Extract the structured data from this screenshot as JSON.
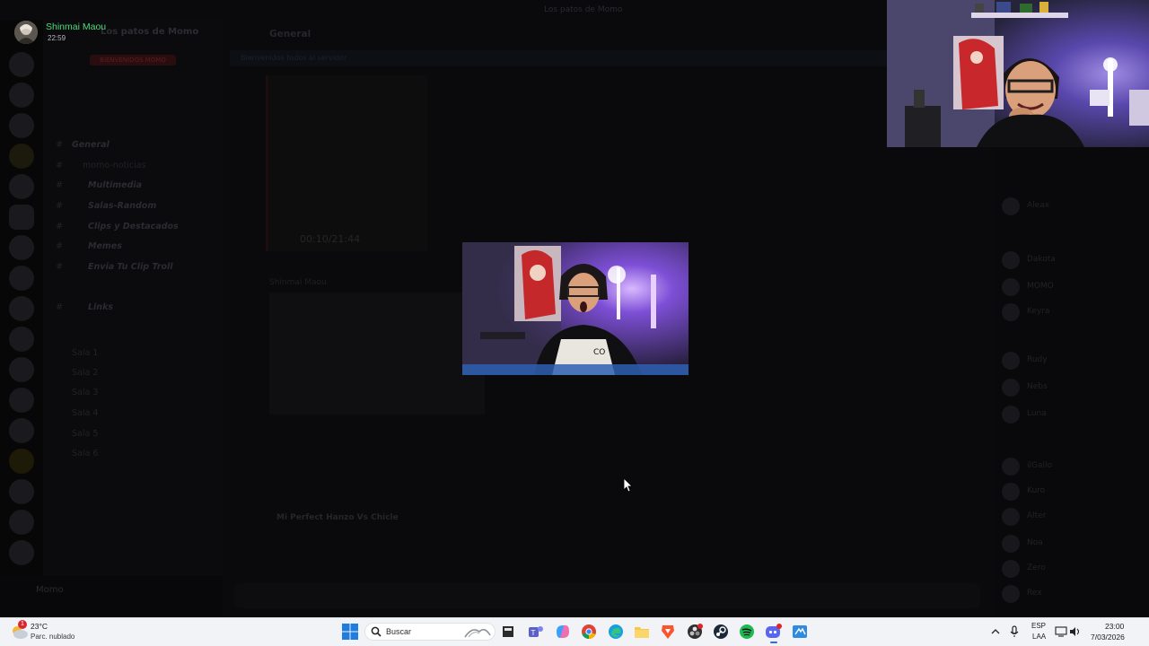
{
  "discord": {
    "window_title": "Los patos de Momo",
    "server_name": "Los patos de Momo",
    "banner_pill": "BIENVENIDOS MOMO",
    "channel_header": "General",
    "notice": "Bienvenidos todos al servidor",
    "channels": [
      {
        "name": "General",
        "style": "italic"
      },
      {
        "name": "momo-noticias",
        "style": "plain"
      },
      {
        "name": "Multimedia",
        "style": "italic"
      },
      {
        "name": "Salas-Random",
        "style": "italic"
      },
      {
        "name": "Clips y Destacados",
        "style": "italic"
      },
      {
        "name": "Memes",
        "style": "italic"
      },
      {
        "name": "Envia Tu Clip Troll",
        "style": "italic"
      },
      {
        "name": "Links",
        "style": "italic"
      }
    ],
    "voice_channels": [
      "Sala 1",
      "Sala 2",
      "Sala 3",
      "Sala 4",
      "Sala 5",
      "Sala 6"
    ],
    "video_time": "00:10/21:44",
    "message_author": "Shinmai Maou",
    "link_title": "Mi Perfect Hanzo Vs Chicle",
    "user_panel_name": "Momo",
    "member_names": [
      "Aleax",
      "Dakota",
      "MOMO",
      "Keyra",
      "Rudy",
      "Nebs",
      "Luna",
      "ilGallo",
      "Kuro",
      "Alter",
      "Noa",
      "Zero",
      "Rex"
    ]
  },
  "live_user": {
    "name": "Shinmai Maou",
    "time": "22:59",
    "name_color": "#4fdc7a"
  },
  "taskbar": {
    "weather_badge": "1",
    "weather_temp": "23°C",
    "weather_condition": "Parc. nublado",
    "search_placeholder": "Buscar",
    "apps": [
      "windows-start",
      "search",
      "file-manager",
      "teams",
      "copilot",
      "chrome",
      "edge",
      "file-explorer",
      "brave",
      "obs",
      "steam",
      "spotify",
      "discord",
      "remote-desktop"
    ],
    "tray_lang_top": "ESP",
    "tray_lang_bottom": "LAA",
    "clock_time": "23:00",
    "clock_date": "7/03/2026"
  }
}
